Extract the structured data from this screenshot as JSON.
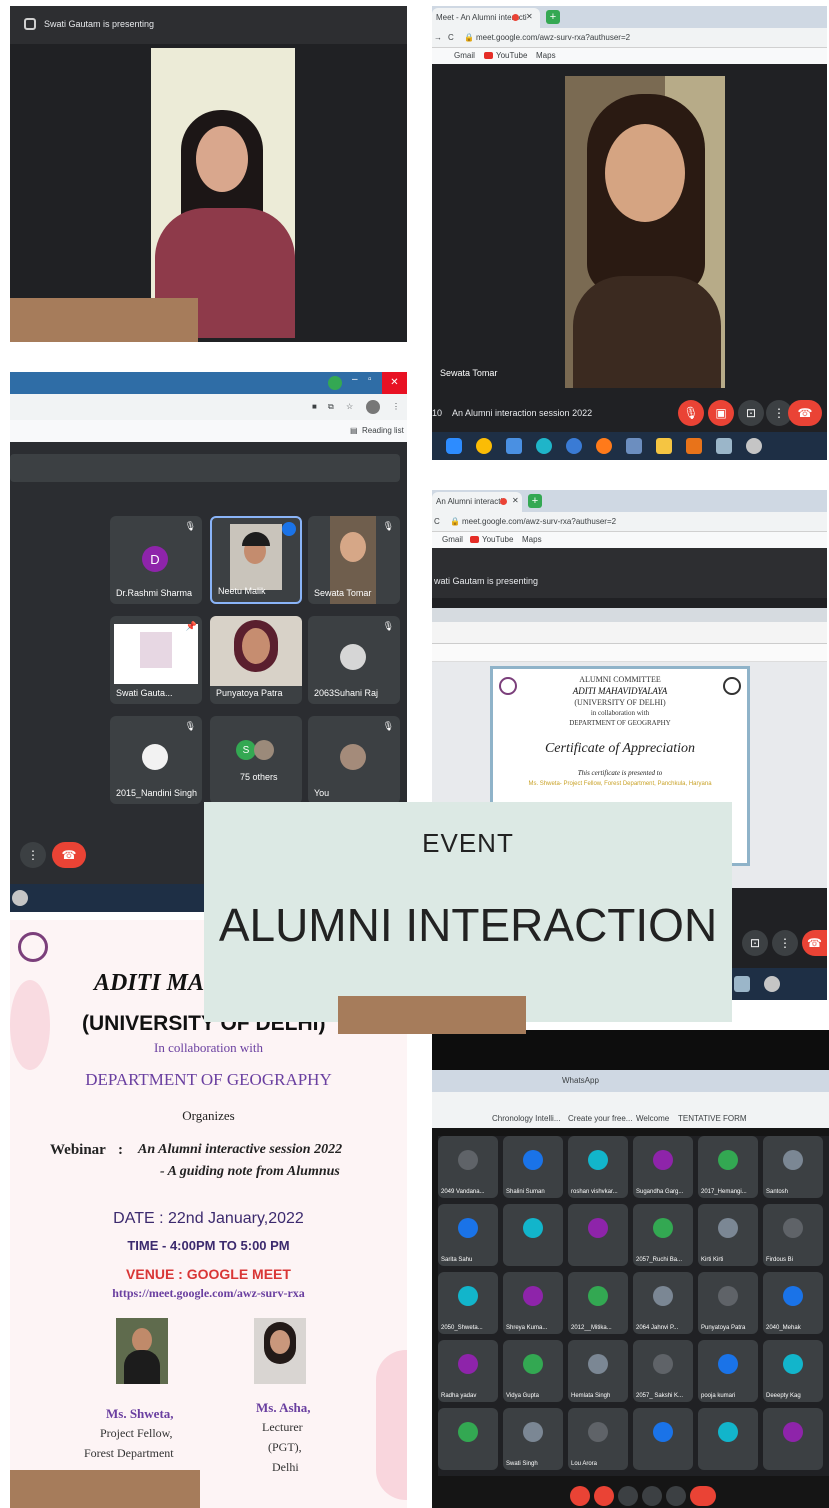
{
  "panel1": {
    "presenting_label": "Swati Gautam is presenting"
  },
  "panel2": {
    "tab_label": "Meet - An Alumni interacti",
    "url": "meet.google.com/awz-surv-rxa?authuser=2",
    "bookmarks": [
      "Gmail",
      "YouTube",
      "Maps"
    ],
    "participant_name": "Sewata Tomar",
    "meeting_title": "An Alumni interaction session 2022",
    "time_prefix": "10"
  },
  "panel3": {
    "reading_list": "Reading list",
    "tiles": [
      {
        "name": "Dr.Rashmi Sharma",
        "avatar": "D"
      },
      {
        "name": "Neetu Malik"
      },
      {
        "name": "Sewata Tomar"
      },
      {
        "name": "Swati Gauta..."
      },
      {
        "name": "Punyatoya Patra"
      },
      {
        "name": "2063Suhani Raj"
      },
      {
        "name": "2015_Nandini Singh"
      },
      {
        "name": "75 others",
        "avatar": "S"
      },
      {
        "name": "You"
      }
    ]
  },
  "panel4": {
    "tab_label": "An Alumni interacti",
    "url": "meet.google.com/awz-surv-rxa?authuser=2",
    "bookmarks": [
      "Gmail",
      "YouTube",
      "Maps"
    ],
    "presenting_label": "wati Gautam is presenting",
    "cert": {
      "line1": "ALUMNI COMMITTEE",
      "line2": "ADITI MAHAVIDYALAYA",
      "line3": "(UNIVERSITY OF DELHI)",
      "line4": "in collaboration with",
      "line5": "DEPARTMENT OF GEOGRAPHY",
      "title": "Certificate of Appreciation",
      "presented": "This certificate is presented to",
      "recipient": "Ms. Shweta- Project Fellow, Forest Department, Panchkula, Haryana"
    }
  },
  "event": {
    "label": "EVENT",
    "title": "ALUMNI INTERACTION"
  },
  "poster": {
    "college": "ADITI MAH",
    "univ": "(UNIVERSITY OF DELHI)",
    "collab": "In collaboration with",
    "dept": "DEPARTMENT OF GEOGRAPHY",
    "organizes": "Organizes",
    "webinar_label": "Webinar",
    "webinar_colon": ":",
    "webinar_title": "An Alumni interactive session 2022",
    "webinar_sub": "- A guiding note from Alumnus",
    "date": "DATE : 22nd January,2022",
    "time": "TIME - 4:00PM TO 5:00 PM",
    "venue": "VENUE : GOOGLE MEET",
    "link": "https://meet.google.com/awz-surv-rxa",
    "speaker1": {
      "name": "Ms. Shweta,",
      "role1": "Project Fellow,",
      "role2": "Forest Department"
    },
    "speaker2": {
      "name": "Ms. Asha,",
      "role1": "Lecturer",
      "role2": "(PGT),",
      "role3": "Delhi"
    }
  },
  "panel6": {
    "tab1": "WhatsApp",
    "bookmarks": [
      "Chronology Intelli...",
      "Create your free...",
      "Welcome",
      "TENTATIVE FORM"
    ],
    "row1": [
      "2049 Vandana...",
      "Shalini Suman",
      "roshan vishvkar...",
      "Sugandha Garg...",
      "2017_Hemangi...",
      "Santosh"
    ],
    "row2": [
      "Sarita Sahu",
      "",
      "",
      "2057_Ruchi Ba...",
      "Kirti Kirti",
      "Firdous Bi"
    ],
    "row3": [
      "2050_Shweta...",
      "Shreya Kuma...",
      "2012__Mitika...",
      "2064 Jahnvi P...",
      "Punyatoya Patra",
      "2040_Mehak"
    ],
    "row4": [
      "Radha yadav",
      "Vidya Gupta",
      "Hemlata Singh",
      "2057_ Sakshi K...",
      "pooja kumari",
      "Deeepty Kag"
    ],
    "row5": [
      "",
      "Swati Singh",
      "Lou Arora",
      "",
      "",
      ""
    ]
  },
  "colors": {
    "meet_red": "#ea4335",
    "meet_dark": "#202124",
    "event_card": "#dce9e4",
    "brown": "#a67c5b",
    "poster_purple": "#6a3fa0",
    "poster_red": "#d93636"
  }
}
